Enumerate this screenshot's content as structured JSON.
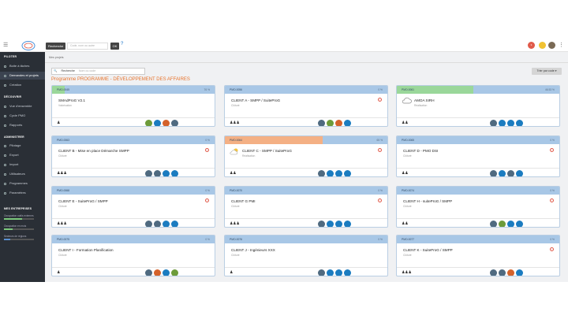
{
  "topbar": {
    "menu_icon": "hamburger-icon",
    "search_label": "Recherche",
    "search_placeholder": "Code, nom ou autre",
    "ok_label": "OK",
    "help": "?",
    "notif_count": "3"
  },
  "sidebar": {
    "section1": "PILOTER",
    "items1": [
      "Boite à tâches",
      "Demandes et projets",
      "Création"
    ],
    "section2": "DÉCOUVRIR",
    "items2": [
      "Vue d'ensemble",
      "Cycle PMO",
      "Rapports"
    ],
    "section3": "ADMINISTRER",
    "items3": [
      "Pilotage",
      "Export",
      "Import",
      "Utilisateurs",
      "Programmes",
      "Paramètres"
    ],
    "section4": "MES ENTREPRISES",
    "ent1": "Occupation outils externes",
    "ent2": "Occupation en mois",
    "ent3": "Secteurs de régions"
  },
  "main": {
    "breadcrumb": "Mes projets",
    "search_label": "Recherche",
    "search_placeholder": "Nom ou code",
    "sort_label": "Trier par code ▾",
    "program_title": "Programme PROGRAMME - DÉVELOPPEMENT DES AFFAIRES"
  },
  "colors": {
    "accent_orange": "#e8742c",
    "head_blue": "#a8c7e6",
    "fill_green": "#9ad79a",
    "fill_orange": "#f4b084",
    "sidebar": "#2a2f36"
  },
  "cards": [
    {
      "code": "PMO-0045",
      "pct": "76 %",
      "progress": 0.08,
      "fill": "#9ad79a",
      "name": "SMAdProG V2.1",
      "sub": "Valorisation",
      "people": "♟",
      "avatars": [
        "#6d9b3a",
        "#1b7cc0",
        "#d4622b",
        "#4f6a80"
      ],
      "icon": "",
      "alert": false
    },
    {
      "code": "PMO-0056",
      "pct": "0 %",
      "progress": 0,
      "fill": "",
      "name": "CLIENT A - SMPP / SuiteProG",
      "sub": "Clôturé",
      "people": "♟♟♟",
      "avatars": [
        "#4f6a80",
        "#6d9b3a",
        "#d4622b",
        "#1b7cc0"
      ],
      "icon": "",
      "alert": true
    },
    {
      "code": "PMO-0061",
      "pct": "46.53 %",
      "progress": 0.47,
      "fill": "#9ad79a",
      "name": "AMOA SIRH",
      "sub": "Réalisation",
      "people": "♟♟",
      "avatars": [
        "#4f6a80",
        "#1b7cc0",
        "#1b7cc0",
        "#1b7cc0"
      ],
      "icon": "cloud",
      "alert": false
    },
    {
      "code": "PMO-0063",
      "pct": "0 %",
      "progress": 0,
      "fill": "",
      "name": "CLIENT B - Mise en place Démarche SMPP",
      "sub": "Clôturé",
      "people": "♟♟♟",
      "avatars": [
        "#4f6a80",
        "#4f6a80",
        "#1b7cc0",
        "#1b7cc0"
      ],
      "icon": "",
      "alert": true
    },
    {
      "code": "PMO-0064",
      "pct": "65 %",
      "progress": 0.6,
      "fill": "#f4b084",
      "name": "CLIENT C - SMPP / SuiteProG",
      "sub": "Réalisation",
      "people": "♟♟",
      "avatars": [
        "#4f6a80",
        "#1b7cc0",
        "#1b7cc0",
        "#1b7cc0"
      ],
      "icon": "sun",
      "alert": true
    },
    {
      "code": "PMO-0065",
      "pct": "0 %",
      "progress": 0,
      "fill": "",
      "name": "CLIENT D - PMO DSI",
      "sub": "Clôturé",
      "people": "♟♟",
      "avatars": [
        "#4f6a80",
        "#1b7cc0",
        "#4f6a80",
        "#1b7cc0"
      ],
      "icon": "",
      "alert": true
    },
    {
      "code": "PMO-0068",
      "pct": "0 %",
      "progress": 0,
      "fill": "",
      "name": "CLIENT E - SuiteProG / SMPP",
      "sub": "Clôturé",
      "people": "♟♟♟",
      "avatars": [
        "#4f6a80",
        "#4f6a80",
        "#1b7cc0",
        "#1b7cc0"
      ],
      "icon": "",
      "alert": true
    },
    {
      "code": "PMO-0070",
      "pct": "0 %",
      "progress": 0,
      "fill": "",
      "name": "CLIENT G PMI",
      "sub": "Clôturé",
      "people": "♟♟♟",
      "avatars": [
        "#4f6a80",
        "#1b7cc0",
        "#1b7cc0",
        "#1b7cc0"
      ],
      "icon": "",
      "alert": true
    },
    {
      "code": "PMO-0074",
      "pct": "0 %",
      "progress": 0,
      "fill": "",
      "name": "CLIENT H - suiteProG / SMPP",
      "sub": "Clôturé",
      "people": "♟♟",
      "avatars": [
        "#4f6a80",
        "#6d9b3a",
        "#1b7cc0",
        "#1b7cc0"
      ],
      "icon": "",
      "alert": true
    },
    {
      "code": "PMO-0075",
      "pct": "0 %",
      "progress": 0,
      "fill": "",
      "name": "CLIENT I - Formation Planification",
      "sub": "Clôturé",
      "people": "♟",
      "avatars": [
        "#4f6a80",
        "#d4622b",
        "#1b7cc0",
        "#6d9b3a"
      ],
      "icon": "",
      "alert": false
    },
    {
      "code": "PMO-0076",
      "pct": "0 %",
      "progress": 0,
      "fill": "",
      "name": "CLIENT J - Ingénieurs XXX",
      "sub": "Clôturé",
      "people": "♟",
      "avatars": [
        "#4f6a80",
        "#1b7cc0",
        "#1b7cc0",
        "#1b7cc0"
      ],
      "icon": "",
      "alert": false
    },
    {
      "code": "PMO-0077",
      "pct": "0 %",
      "progress": 0,
      "fill": "",
      "name": "CLIENT K - SuiteProG / SMPP",
      "sub": "Clôturé",
      "people": "♟♟♟",
      "avatars": [
        "#4f6a80",
        "#4f6a80",
        "#d4622b",
        "#1b7cc0"
      ],
      "icon": "",
      "alert": true
    }
  ]
}
